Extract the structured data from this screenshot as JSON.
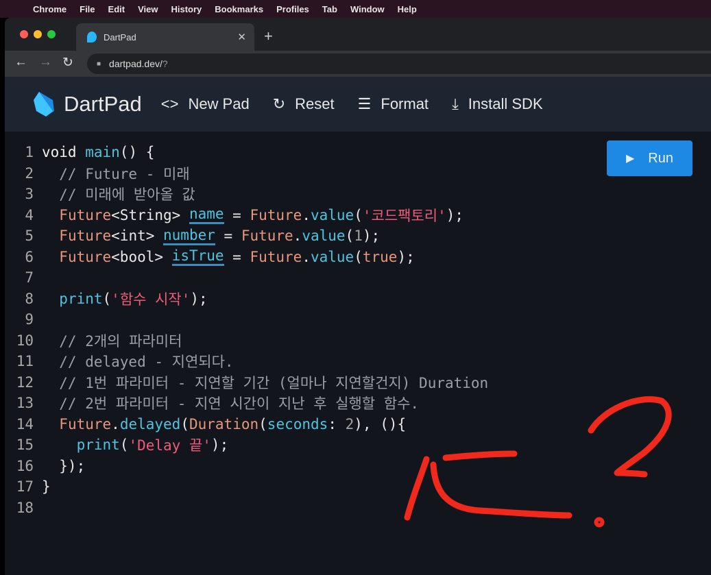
{
  "menubar": {
    "items": [
      "Chrome",
      "File",
      "Edit",
      "View",
      "History",
      "Bookmarks",
      "Profiles",
      "Tab",
      "Window",
      "Help"
    ]
  },
  "browser": {
    "tab_title": "DartPad",
    "url": "dartpad.dev/",
    "url_query": "?"
  },
  "header": {
    "brand": "DartPad",
    "new_pad": "New Pad",
    "reset": "Reset",
    "format": "Format",
    "install_sdk": "Install SDK"
  },
  "run_label": "Run",
  "code": [
    [
      [
        "void ",
        "kw"
      ],
      [
        "main",
        "fn"
      ],
      [
        "() {",
        "pl"
      ]
    ],
    [
      [
        "  // Future - 미래",
        "cm"
      ]
    ],
    [
      [
        "  // 미래에 받아올 값",
        "cm"
      ]
    ],
    [
      [
        "  ",
        "pl"
      ],
      [
        "Future",
        "ty"
      ],
      [
        "<String> ",
        "pl"
      ],
      [
        "name",
        "fn ul"
      ],
      [
        " = ",
        "pl"
      ],
      [
        "Future",
        "ty"
      ],
      [
        ".",
        "pl"
      ],
      [
        "value",
        "fn"
      ],
      [
        "(",
        "pl"
      ],
      [
        "'코드팩토리'",
        "st"
      ],
      [
        ");",
        "pl"
      ]
    ],
    [
      [
        "  ",
        "pl"
      ],
      [
        "Future",
        "ty"
      ],
      [
        "<int> ",
        "pl"
      ],
      [
        "number",
        "fn ul"
      ],
      [
        " = ",
        "pl"
      ],
      [
        "Future",
        "ty"
      ],
      [
        ".",
        "pl"
      ],
      [
        "value",
        "fn"
      ],
      [
        "(",
        "pl"
      ],
      [
        "1",
        "nu"
      ],
      [
        ");",
        "pl"
      ]
    ],
    [
      [
        "  ",
        "pl"
      ],
      [
        "Future",
        "ty"
      ],
      [
        "<bool> ",
        "pl"
      ],
      [
        "isTrue",
        "fn ul"
      ],
      [
        " = ",
        "pl"
      ],
      [
        "Future",
        "ty"
      ],
      [
        ".",
        "pl"
      ],
      [
        "value",
        "fn"
      ],
      [
        "(",
        "pl"
      ],
      [
        "true",
        "ty"
      ],
      [
        ");",
        "pl"
      ]
    ],
    [],
    [
      [
        "  ",
        "pl"
      ],
      [
        "print",
        "fn"
      ],
      [
        "(",
        "pl"
      ],
      [
        "'함수 시작'",
        "st"
      ],
      [
        ");",
        "pl"
      ]
    ],
    [],
    [
      [
        "  // 2개의 파라미터",
        "cm"
      ]
    ],
    [
      [
        "  // delayed - 지연되다.",
        "cm"
      ]
    ],
    [
      [
        "  // 1번 파라미터 - 지연할 기간 (얼마나 지연할건지) Duration",
        "cm"
      ]
    ],
    [
      [
        "  // 2번 파라미터 - 지연 시간이 지난 후 실행할 함수.",
        "cm"
      ]
    ],
    [
      [
        "  ",
        "pl"
      ],
      [
        "Future",
        "ty"
      ],
      [
        ".",
        "pl"
      ],
      [
        "delayed",
        "fn"
      ],
      [
        "(",
        "pl"
      ],
      [
        "Duration",
        "ty"
      ],
      [
        "(",
        "pl"
      ],
      [
        "seconds",
        "fn"
      ],
      [
        ": ",
        "pl"
      ],
      [
        "2",
        "nu"
      ],
      [
        "), (){",
        "pl"
      ]
    ],
    [
      [
        "    ",
        "pl"
      ],
      [
        "print",
        "fn"
      ],
      [
        "(",
        "pl"
      ],
      [
        "'Delay 끝'",
        "st"
      ],
      [
        ");",
        "pl"
      ]
    ],
    [
      [
        "  });",
        "pl"
      ]
    ],
    [
      [
        "}",
        "pl"
      ]
    ],
    []
  ]
}
